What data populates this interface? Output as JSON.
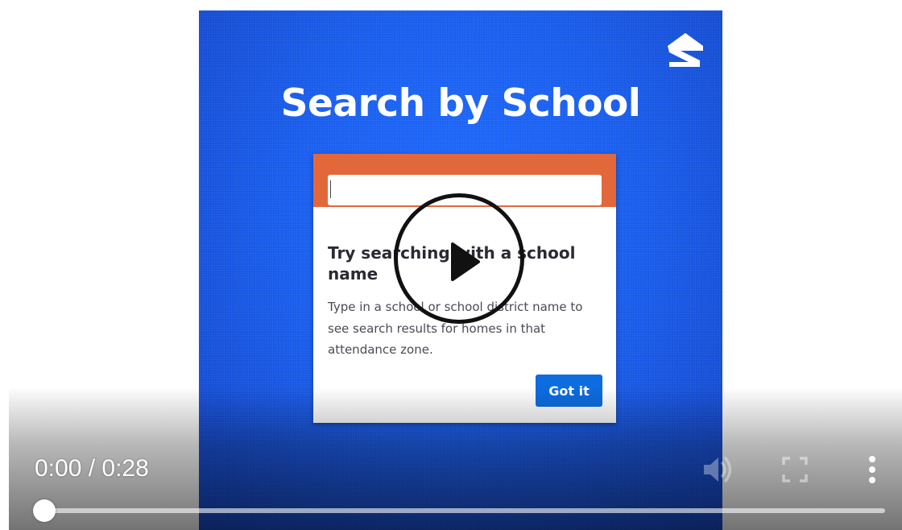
{
  "video": {
    "headline": "Search by School",
    "card": {
      "input_value": "",
      "title": "Try searching with a school name",
      "body": "Type in a school or school district name to see search results for homes in that attendance zone.",
      "button_label": "Got it"
    },
    "brand_icon": "zillow-logo-icon",
    "colors": {
      "background": "#1a5ff0",
      "card_header": "#e2683b",
      "button": "#0d6ce0"
    }
  },
  "controls": {
    "current_time": "0:00",
    "separator": " / ",
    "duration": "0:28",
    "progress": 0,
    "icons": {
      "play": "play-icon",
      "volume": "volume-icon",
      "fullscreen": "fullscreen-icon",
      "more": "more-vertical-icon"
    }
  }
}
